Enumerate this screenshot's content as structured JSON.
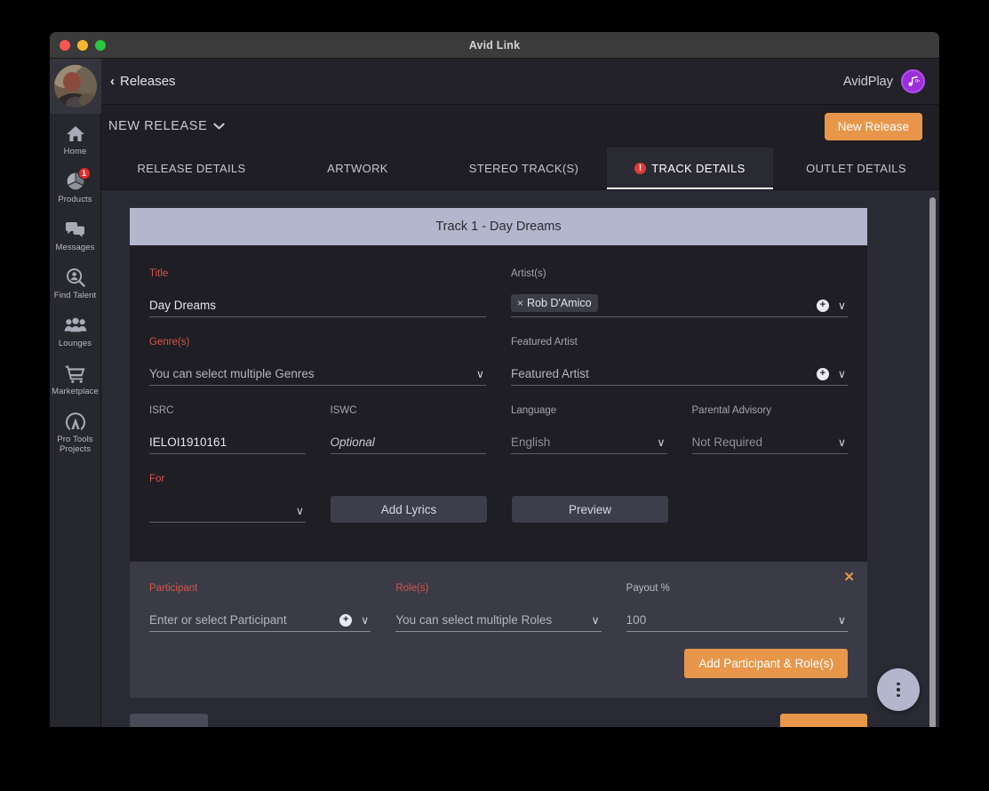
{
  "window": {
    "title": "Avid Link",
    "controls": [
      "close",
      "minimize",
      "maximize"
    ]
  },
  "sidebar": {
    "avatar_name": "user-avatar",
    "items": [
      {
        "label": "Home",
        "icon": "home-icon",
        "badge": null
      },
      {
        "label": "Products",
        "icon": "products-icon",
        "badge": "1"
      },
      {
        "label": "Messages",
        "icon": "messages-icon",
        "badge": null
      },
      {
        "label": "Find Talent",
        "icon": "find-talent-icon",
        "badge": null
      },
      {
        "label": "Lounges",
        "icon": "lounges-icon",
        "badge": null
      },
      {
        "label": "Marketplace",
        "icon": "marketplace-icon",
        "badge": null
      },
      {
        "label": "Pro Tools Projects",
        "icon": "pro-tools-icon",
        "badge": null
      }
    ]
  },
  "topbar": {
    "back_label": "Releases",
    "back_chevron": "‹",
    "brand_name": "AvidPlay",
    "brand_logo_icon": "avidplay-music-note-icon"
  },
  "subheader": {
    "release_title": "NEW RELEASE",
    "caret": "⌄",
    "new_release_button": "New Release"
  },
  "tabs": [
    {
      "label": "RELEASE DETAILS",
      "active": false,
      "error": false
    },
    {
      "label": "ARTWORK",
      "active": false,
      "error": false
    },
    {
      "label": "STEREO TRACK(S)",
      "active": false,
      "error": false
    },
    {
      "label": "TRACK DETAILS",
      "active": true,
      "error": true,
      "error_glyph": "!"
    },
    {
      "label": "OUTLET DETAILS",
      "active": false,
      "error": false
    }
  ],
  "track": {
    "header": "Track  1 - Day Dreams",
    "fields": {
      "title": {
        "label": "Title",
        "required": true,
        "value": "Day Dreams"
      },
      "artists": {
        "label": "Artist(s)",
        "required": false,
        "chips": [
          {
            "text": "Rob D'Amico",
            "remove": "×"
          }
        ],
        "add_icon": "plus-circle-icon",
        "caret": "∨"
      },
      "genres": {
        "label": "Genre(s)",
        "required": true,
        "placeholder": "You can select multiple Genres",
        "caret": "∨"
      },
      "featured_artist": {
        "label": "Featured Artist",
        "required": false,
        "placeholder": "Featured Artist",
        "add_icon": "plus-circle-icon",
        "caret": "∨"
      },
      "isrc": {
        "label": "ISRC",
        "required": false,
        "value": "IELOI1910161"
      },
      "iswc": {
        "label": "ISWC",
        "required": false,
        "placeholder": "Optional"
      },
      "language": {
        "label": "Language",
        "required": false,
        "value": "English",
        "caret": "∨"
      },
      "parental_advisory": {
        "label": "Parental Advisory",
        "required": false,
        "value": "Not Required",
        "caret": "∨"
      },
      "for": {
        "label": "For",
        "required": true,
        "value": "",
        "caret": "∨"
      }
    },
    "buttons": {
      "add_lyrics": "Add Lyrics",
      "preview": "Preview"
    }
  },
  "participant": {
    "close_glyph": "✕",
    "fields": {
      "participant": {
        "label": "Participant",
        "required": true,
        "placeholder": "Enter or select Participant",
        "add_icon": "plus-circle-icon",
        "caret": "∨"
      },
      "roles": {
        "label": "Role(s)",
        "required": true,
        "placeholder": "You can select multiple Roles",
        "caret": "∨"
      },
      "payout": {
        "label": "Payout %",
        "required": false,
        "value": "100",
        "caret": "∨"
      }
    },
    "add_button": "Add Participant & Role(s)"
  },
  "fab": {
    "icon": "more-vertical-icon"
  },
  "colors": {
    "accent_orange": "#e8964a",
    "required_red": "#d9564a",
    "error_red": "#e03b34",
    "header_lavender": "#b3b6cc",
    "brand_purple": "#9b30d9",
    "panel_bg": "#2a2a35",
    "card_bg": "#1e1e24",
    "participant_bg": "#3a3b47"
  }
}
